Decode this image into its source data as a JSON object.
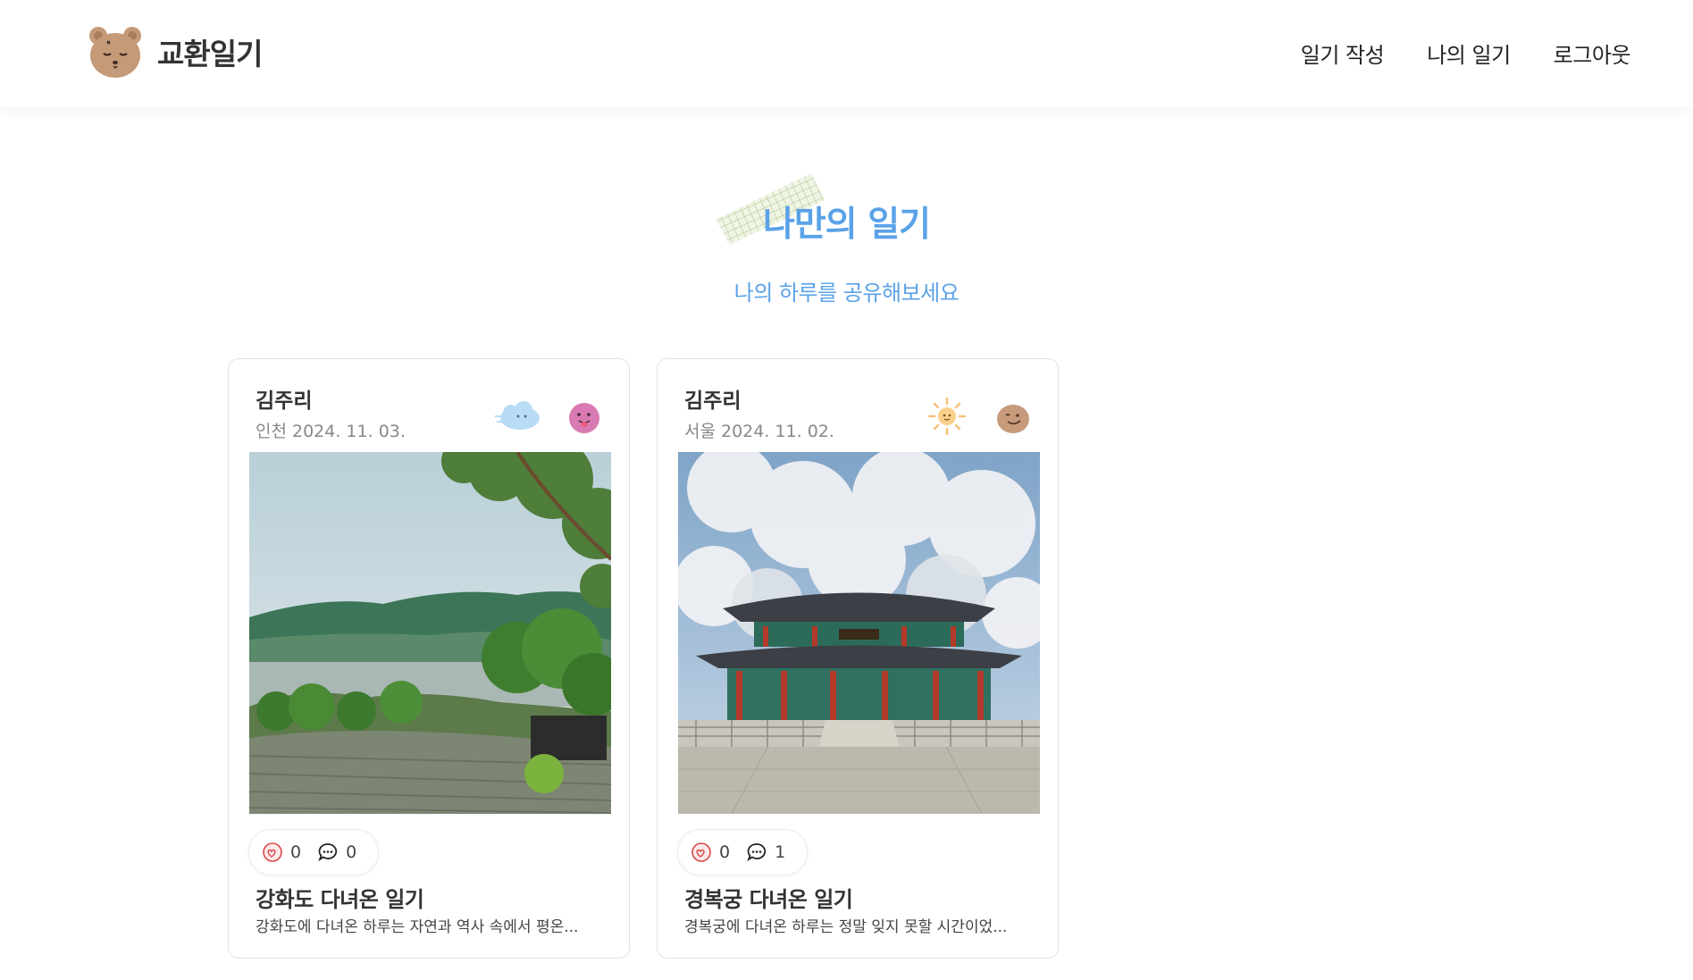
{
  "app": {
    "logo_text": "교환일기"
  },
  "nav": {
    "write": "일기 작성",
    "my_diary": "나의 일기",
    "logout": "로그아웃"
  },
  "hero": {
    "title": "나만의 일기",
    "subtitle": "나의 하루를 공유해보세요"
  },
  "posts": [
    {
      "author": "김주리",
      "meta": "인천 2024. 11. 03.",
      "weather_icon": "cloud-icon",
      "mood_icon": "tongue-face-icon",
      "likes": "0",
      "comments": "0",
      "title": "강화도 다녀온 일기",
      "excerpt": "강화도에 다녀온 하루는 자연과 역사 속에서 평온..."
    },
    {
      "author": "김주리",
      "meta": "서울 2024. 11. 02.",
      "weather_icon": "sun-icon",
      "mood_icon": "smile-face-icon",
      "likes": "0",
      "comments": "1",
      "title": "경복궁 다녀온 일기",
      "excerpt": "경복궁에 다녀온 하루는 정말 잊지 못할 시간이었..."
    }
  ],
  "colors": {
    "accent": "#5aa2e8",
    "bear": "#c49a78",
    "like": "#e05a5a"
  }
}
